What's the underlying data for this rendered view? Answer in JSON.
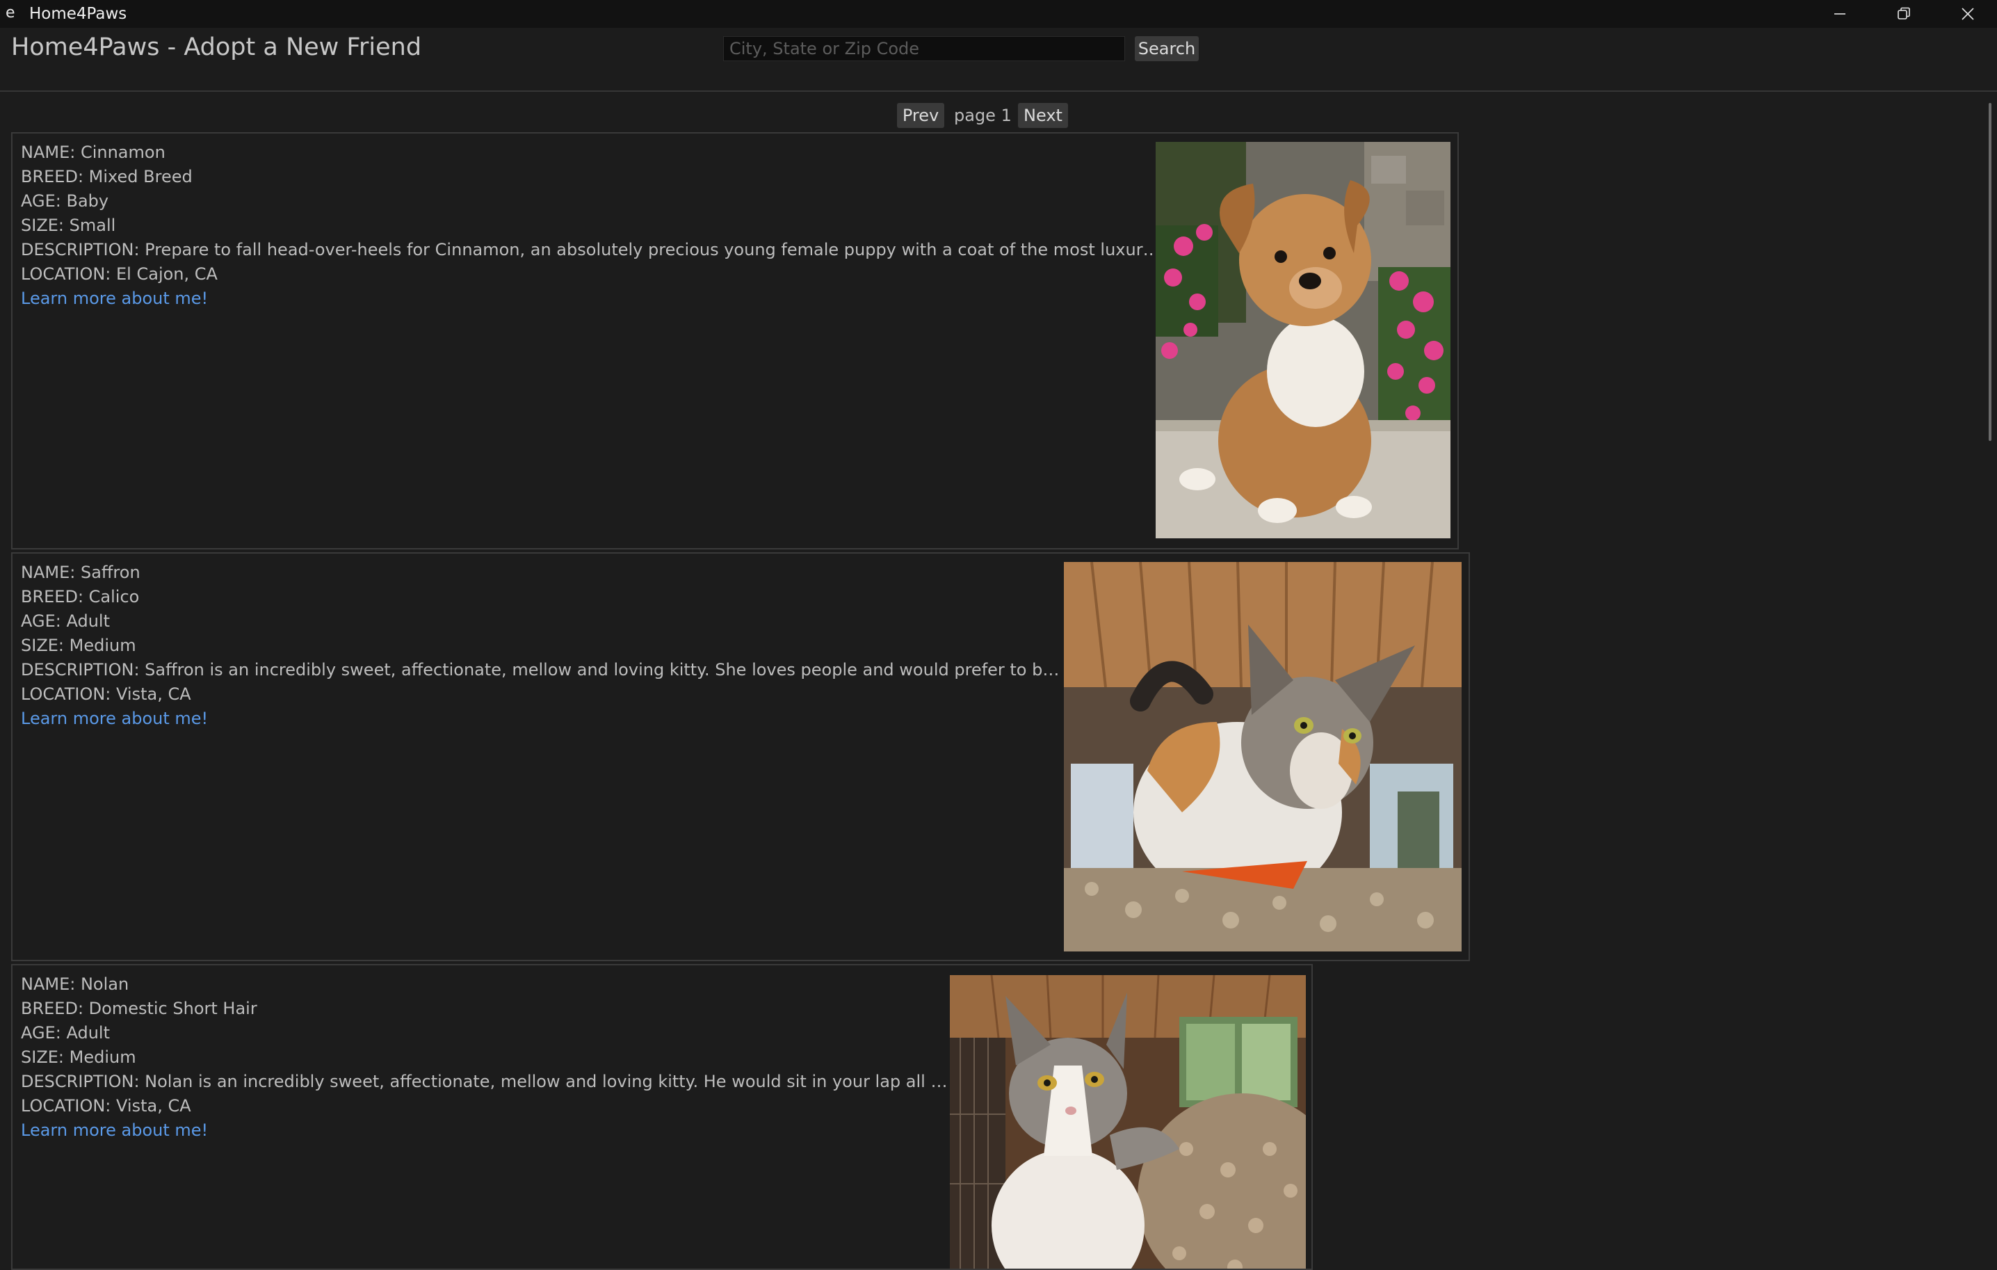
{
  "window": {
    "app_icon_glyph": "e",
    "title": "Home4Paws",
    "controls": [
      "minimize-icon",
      "restore-icon",
      "close-icon"
    ]
  },
  "header": {
    "title": "Home4Paws - Adopt a New Friend",
    "search_placeholder": "City, State or Zip Code",
    "search_value": "",
    "search_button": "Search"
  },
  "pager": {
    "prev": "Prev",
    "page_label": "page 1",
    "next": "Next"
  },
  "pets": [
    {
      "name": "NAME: Cinnamon",
      "breed": "BREED: Mixed Breed",
      "age": "AGE: Baby",
      "size": "SIZE: Small",
      "description": "DESCRIPTION: Prepare to fall head-over-heels for Cinnamon, an absolutely precious young female puppy with a coat of the most luxurious, soft...",
      "location": "LOCATION: El Cajon, CA",
      "link": "Learn more about me!",
      "photo": "puppy-photo"
    },
    {
      "name": "NAME: Saffron",
      "breed": "BREED: Calico",
      "age": "AGE: Adult",
      "size": "SIZE: Medium",
      "description": "DESCRIPTION: Saffron is an incredibly sweet, affectionate, mellow and loving kitty. She loves people and would prefer to be an only...",
      "location": "LOCATION: Vista, CA",
      "link": "Learn more about me!",
      "photo": "calico-cat-photo"
    },
    {
      "name": "NAME: Nolan",
      "breed": "BREED: Domestic Short Hair",
      "age": "AGE: Adult",
      "size": "SIZE: Medium",
      "description": "DESCRIPTION: Nolan is an incredibly sweet, affectionate, mellow and loving kitty. He would sit in your lap all day if he...",
      "location": "LOCATION: Vista, CA",
      "link": "Learn more about me!",
      "photo": "gray-white-cat-photo"
    }
  ],
  "colors": {
    "background": "#1c1c1c",
    "titlebar": "#121212",
    "text": "#bdbdbd",
    "link": "#5b9ae8",
    "button": "#3a3a3a",
    "border": "#3a3a3a"
  }
}
